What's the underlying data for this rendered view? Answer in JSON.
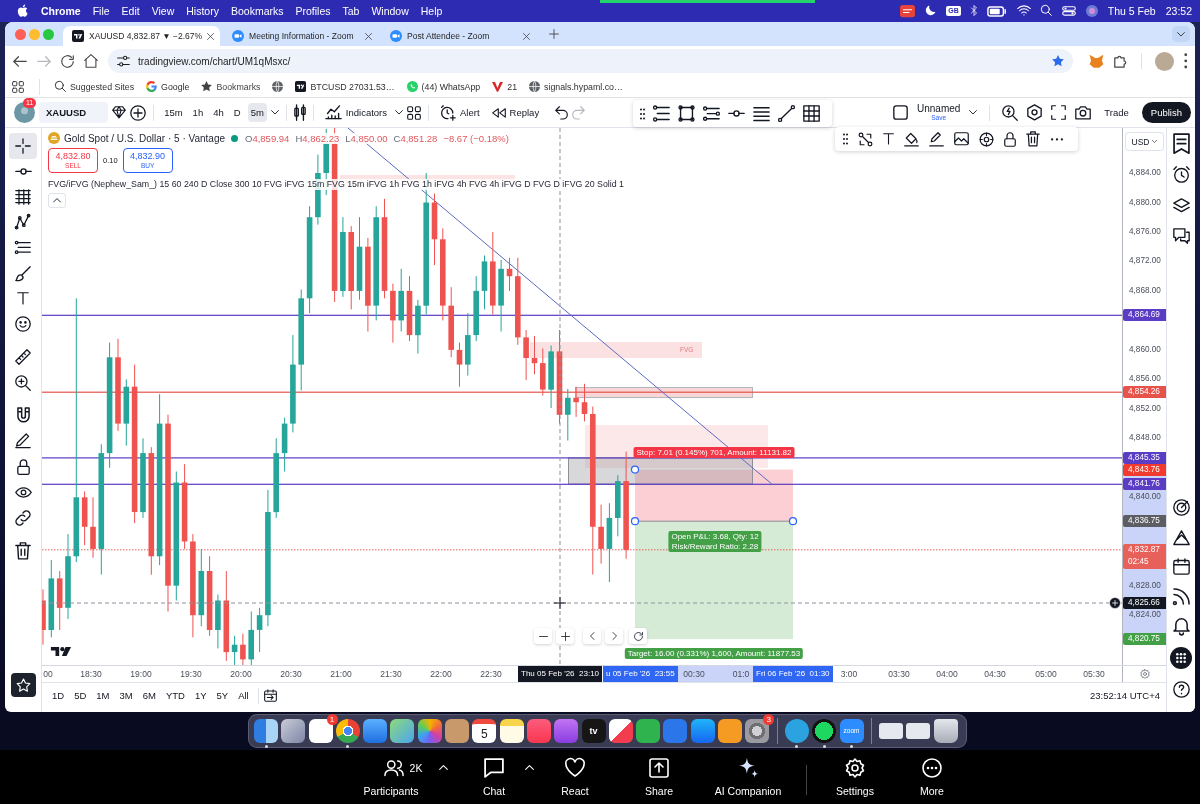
{
  "menu_bar": {
    "app": "Chrome",
    "items": [
      "File",
      "Edit",
      "View",
      "History",
      "Bookmarks",
      "Profiles",
      "Tab",
      "Window",
      "Help"
    ],
    "input_source": "GB",
    "date": "Thu 5 Feb",
    "time": "23:52"
  },
  "browser": {
    "tabs": [
      {
        "title": "XAUUSD 4,832.87 ▼ −2.67%",
        "kind": "chart",
        "selected": true
      },
      {
        "title": "Meeting Information - Zoom",
        "kind": "meeting",
        "selected": false
      },
      {
        "title": "Post Attendee - Zoom",
        "kind": "meeting",
        "selected": false
      }
    ],
    "url": "tradingview.com/chart/UM1qMsxc/",
    "bookmarked": true,
    "bookmarks": [
      {
        "label": "Suggested Sites",
        "kind": "search"
      },
      {
        "label": "Google",
        "kind": "google"
      },
      {
        "label": "Bookmarks",
        "kind": "star"
      },
      {
        "kind": "globe"
      },
      {
        "label": "BTCUSD 27031.53…",
        "kind": "chart"
      },
      {
        "label": "(44) WhatsApp",
        "kind": "whatsapp"
      },
      {
        "label": "21",
        "kind": "v"
      },
      {
        "label": "signals.hypaml.co…",
        "kind": "globe"
      }
    ]
  },
  "chart_app": {
    "toolbar": {
      "notifications": "11",
      "symbol": "XAUUSD",
      "intervals": [
        {
          "label": "15m",
          "selected": false
        },
        {
          "label": "1h",
          "selected": false
        },
        {
          "label": "4h",
          "selected": false
        },
        {
          "label": "D",
          "selected": false
        },
        {
          "label": "5m",
          "selected": true
        }
      ],
      "indicators": "Indicators",
      "alert": "Alert",
      "replay": "Replay",
      "layout_name": "Unnamed",
      "layout_status": "Save",
      "trade": "Trade",
      "publish": "Publish"
    },
    "drawing_tools": [
      {
        "kind": "crosshair",
        "selected": true
      },
      {
        "kind": "trend",
        "selected": false
      },
      {
        "kind": "fib",
        "selected": false
      },
      {
        "kind": "pattern",
        "selected": false
      },
      {
        "kind": "projection",
        "selected": false
      },
      {
        "kind": "brush",
        "selected": false
      },
      {
        "kind": "text",
        "selected": false
      },
      {
        "kind": "emoji",
        "selected": false
      },
      {
        "kind": "ruler",
        "selected": false
      },
      {
        "kind": "zoom",
        "selected": false
      },
      {
        "kind": "magnet",
        "selected": false
      },
      {
        "kind": "stay_drawing",
        "selected": false
      },
      {
        "kind": "lock",
        "selected": false
      },
      {
        "kind": "hide",
        "selected": false
      },
      {
        "kind": "link",
        "selected": false
      },
      {
        "kind": "remove",
        "selected": false
      }
    ],
    "legend": {
      "title": "Gold Spot / U.S. Dollar · 5 · Vantage",
      "market_open": true,
      "ohlc": [
        {
          "key": "O",
          "value": "4,859.94"
        },
        {
          "key": "H",
          "value": "4,862.23"
        },
        {
          "key": "L",
          "value": "4,850.00"
        },
        {
          "key": "C",
          "value": "4,851.28"
        }
      ],
      "change": "−8.67 (−0.18%)"
    },
    "quote": {
      "sell_price": "4,832.80",
      "sell_label": "SELL",
      "spread": "0.10",
      "buy_price": "4,832.90",
      "buy_label": "BUY"
    },
    "indicator": "FVG/iFVG (Nephew_Sam_) 15 60 240 D Close 300 10 FVG iFVG 15m FVG 15m iFVG 1h FVG 1h iFVG 4h FVG 4h iFVG D FVG D iFVG 20 Solid 1",
    "fvg_label": "FVG",
    "position": {
      "stop": "Stop: 7.01 (0.145%) 701, Amount: 11131.82",
      "pnl": "Open P&L: 3.68, Qty: 12",
      "ratio": "Risk/Reward Ratio: 2.28",
      "target": "Target: 16.00 (0.331%) 1,600, Amount: 11877.53"
    },
    "price_axis": {
      "currency": "USD",
      "ticks": [
        "4,884.00",
        "4,880.00",
        "4,876.00",
        "4,872.00",
        "4,868.00",
        "4,860.00",
        "4,856.00",
        "4,852.00",
        "4,848.00",
        "4,840.00",
        "4,828.00",
        "4,824.00"
      ],
      "labels": [
        {
          "value": "4,864.69",
          "kind": "line",
          "color": "#5b3cc4"
        },
        {
          "value": "4,854.26",
          "kind": "line",
          "color": "#e5534b"
        },
        {
          "value": "4,845.35",
          "kind": "line",
          "color": "#5b3cc4"
        },
        {
          "value": "4,843.76",
          "kind": "stop",
          "color": "#f23b2f"
        },
        {
          "value": "4,841.76",
          "kind": "line",
          "color": "#5b3cc4"
        },
        {
          "value": "4,836.75",
          "kind": "entry",
          "color": "#5d5e63"
        },
        {
          "value": "4,832.87",
          "sub": "02:45",
          "kind": "current",
          "color": "#e8605a"
        },
        {
          "value": "4,825.66",
          "kind": "crosshair",
          "color": "#131722"
        },
        {
          "value": "4,820.75",
          "kind": "target",
          "color": "#43a047"
        }
      ]
    },
    "time_axis": {
      "ticks": [
        "00",
        "18:30",
        "19:00",
        "19:30",
        "20:00",
        "20:30",
        "21:00",
        "21:30",
        "22:00",
        "22:30",
        "00:30",
        "01:0",
        "3:00",
        "03:30",
        "04:00",
        "04:30",
        "05:00",
        "05:30"
      ],
      "markers": [
        {
          "label": "Thu 05 Feb '26  23:10",
          "kind": "crosshair"
        },
        {
          "label": "u 05 Feb '26  23:55",
          "kind": "position"
        },
        {
          "label": "Fri 06 Feb '26  01:30",
          "kind": "position"
        }
      ]
    },
    "ranges": [
      "1D",
      "5D",
      "1M",
      "3M",
      "6M",
      "YTD",
      "1Y",
      "5Y",
      "All"
    ],
    "clock": "23:52:14 UTC+4"
  },
  "dock": {
    "pinned": [
      {
        "kind": "finder",
        "running": true
      },
      {
        "kind": "launchpad",
        "running": false
      },
      {
        "kind": "reminders",
        "badge": "1",
        "running": false
      },
      {
        "kind": "chrome",
        "running": true
      },
      {
        "kind": "mail",
        "running": false
      },
      {
        "kind": "maps",
        "running": false
      },
      {
        "kind": "photos",
        "running": false
      },
      {
        "kind": "contacts",
        "running": false
      },
      {
        "kind": "calendar",
        "text": "5",
        "running": false
      },
      {
        "kind": "notes",
        "running": false
      },
      {
        "kind": "music",
        "running": false
      },
      {
        "kind": "podcasts",
        "running": false
      },
      {
        "kind": "tv",
        "text": "tv",
        "running": false
      },
      {
        "kind": "news",
        "running": false
      },
      {
        "kind": "numbers",
        "running": false
      },
      {
        "kind": "keynote",
        "running": false
      },
      {
        "kind": "appstore",
        "running": false
      },
      {
        "kind": "pages",
        "running": false
      },
      {
        "kind": "settings",
        "badge": "3",
        "running": false
      }
    ],
    "recent": [
      {
        "kind": "telegram",
        "running": true
      },
      {
        "kind": "spotify",
        "running": true
      },
      {
        "kind": "zoom",
        "text": "zoom",
        "running": true
      }
    ],
    "minimized": [
      {
        "kind": "window"
      },
      {
        "kind": "window"
      },
      {
        "kind": "trash"
      }
    ]
  },
  "meeting_toolbar": [
    {
      "kind": "participants",
      "label": "Participants",
      "count": "2K",
      "menu": true
    },
    {
      "kind": "chat",
      "label": "Chat",
      "menu": true
    },
    {
      "kind": "react",
      "label": "React",
      "menu": false
    },
    {
      "kind": "share",
      "label": "Share",
      "menu": false
    },
    {
      "kind": "ai",
      "label": "AI Companion",
      "menu": false
    },
    {
      "kind": "settings",
      "label": "Settings",
      "menu": false
    },
    {
      "kind": "more",
      "label": "More",
      "menu": false
    }
  ]
}
